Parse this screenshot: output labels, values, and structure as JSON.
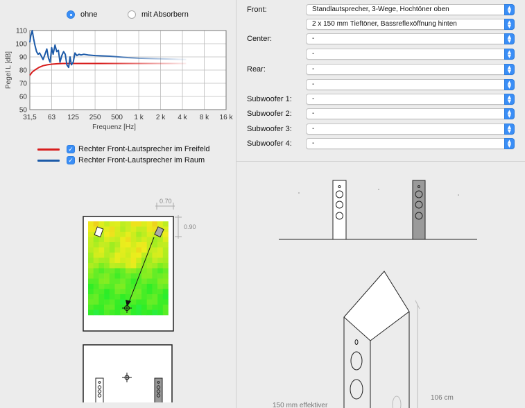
{
  "mode": {
    "options": [
      {
        "label": "ohne",
        "selected": true
      },
      {
        "label": "mit Absorbern",
        "selected": false
      }
    ]
  },
  "chart_data": {
    "type": "line",
    "ylabel": "Pegel L [dB]",
    "xlabel": "Frequenz [Hz]",
    "x_scale": "log",
    "x_ticks": [
      {
        "label": "31,5",
        "value": 31.5
      },
      {
        "label": "63",
        "value": 63
      },
      {
        "label": "125",
        "value": 125
      },
      {
        "label": "250",
        "value": 250
      },
      {
        "label": "500",
        "value": 500
      },
      {
        "label": "1 k",
        "value": 1000
      },
      {
        "label": "2 k",
        "value": 2000
      },
      {
        "label": "4 k",
        "value": 4000
      },
      {
        "label": "8 k",
        "value": 8000
      },
      {
        "label": "16 k",
        "value": 16000
      }
    ],
    "y_ticks": [
      50,
      60,
      70,
      80,
      90,
      100,
      110
    ],
    "xlim": [
      31.5,
      16000
    ],
    "ylim": [
      50,
      110
    ],
    "grid": true,
    "series": [
      {
        "name": "Rechter Front-Lautsprecher im Freifeld",
        "color": "#d81e1e",
        "x": [
          31.5,
          34,
          38,
          42,
          48,
          55,
          63,
          75,
          90,
          110,
          150,
          250,
          500,
          1000,
          2000,
          4500
        ],
        "y": [
          76,
          78.5,
          80.5,
          82,
          83.3,
          84,
          84.5,
          84.8,
          85,
          85,
          85,
          85,
          85,
          85,
          85,
          85
        ]
      },
      {
        "name": "Rechter Front-Lautsprecher im Raum",
        "color": "#1c5aa8",
        "x": [
          31.5,
          32.5,
          34,
          35.5,
          37,
          39,
          41,
          43,
          45,
          48,
          51,
          54,
          57,
          60,
          63,
          66,
          70,
          74,
          78,
          82,
          87,
          92,
          97,
          102,
          108,
          113,
          118,
          125,
          132,
          140,
          150,
          160,
          175,
          200,
          250,
          400,
          700,
          1000,
          2000,
          4500
        ],
        "y": [
          101,
          106,
          110,
          104,
          99,
          94,
          92,
          93,
          91,
          88,
          92,
          96,
          89,
          86,
          97,
          92,
          99,
          94,
          95,
          86,
          91,
          94,
          92,
          84,
          82,
          90,
          84,
          86,
          93,
          91,
          92,
          91.5,
          92,
          91.5,
          91,
          90.5,
          89.5,
          89,
          88.5,
          88
        ]
      }
    ]
  },
  "room": {
    "dim_width": "0.70",
    "dim_depth": "0.90"
  },
  "speakers": {
    "rows": [
      {
        "label": "Front:",
        "value": "Standlautsprecher, 3-Wege, Hochtöner oben"
      },
      {
        "label": "",
        "value": "2 x 150 mm Tieftöner, Bassreflexöffnung hinten"
      },
      {
        "label": "Center:",
        "value": "-"
      },
      {
        "label": "",
        "value": "-"
      },
      {
        "label": "Rear:",
        "value": "-"
      },
      {
        "label": "",
        "value": "-"
      },
      {
        "label": "Subwoofer 1:",
        "value": "-"
      },
      {
        "label": "Subwoofer 2:",
        "value": "-"
      },
      {
        "label": "Subwoofer 3:",
        "value": "-"
      },
      {
        "label": "Subwoofer 4:",
        "value": "-"
      }
    ]
  },
  "speaker_drawing": {
    "height_label": "106 cm",
    "woofer_label": "150 mm effektiver"
  }
}
